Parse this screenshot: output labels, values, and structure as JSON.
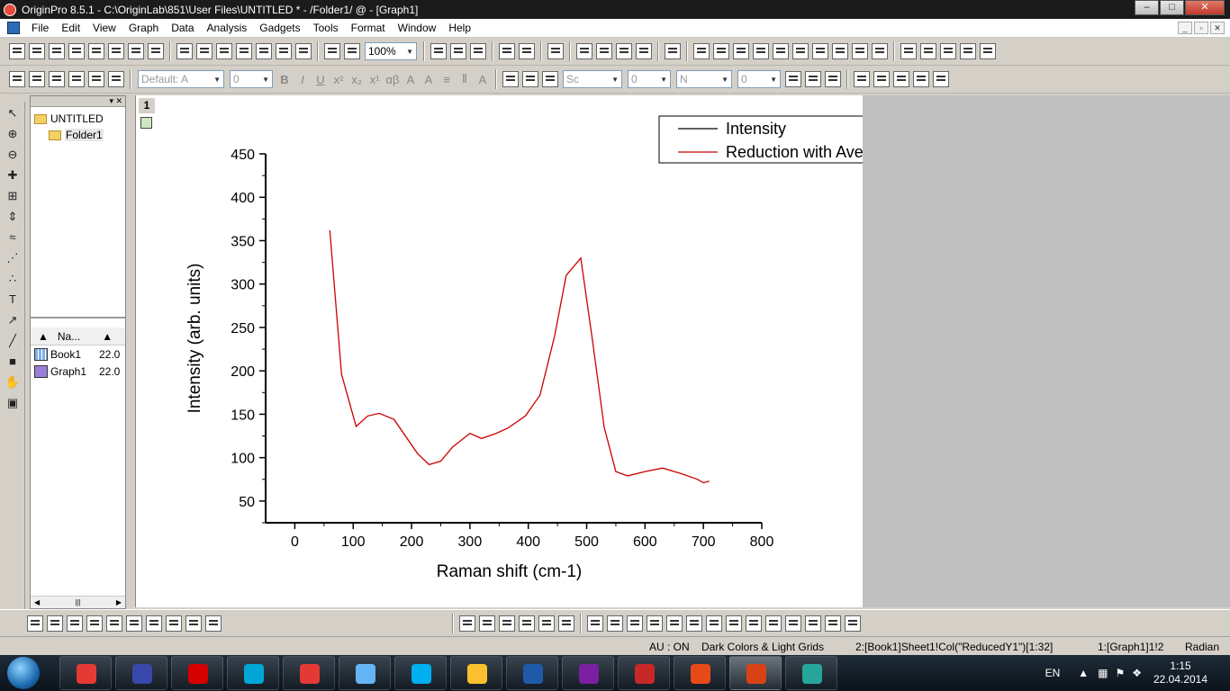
{
  "window": {
    "title": "OriginPro 8.5.1 - C:\\OriginLab\\851\\User Files\\UNTITLED * - /Folder1/ @ - [Graph1]"
  },
  "menu": [
    "File",
    "Edit",
    "View",
    "Graph",
    "Data",
    "Analysis",
    "Gadgets",
    "Tools",
    "Format",
    "Window",
    "Help"
  ],
  "toolbar": {
    "zoom": "100%",
    "font_name": "Default: A",
    "font_size": "0",
    "line_style": "Sc",
    "line_width": "0",
    "border_color": "N",
    "pattern_width": "0"
  },
  "explorer": {
    "root": "UNTITLED",
    "folder": "Folder1",
    "list_header": "Na...",
    "items": [
      {
        "name": "Book1",
        "date": "22.0"
      },
      {
        "name": "Graph1",
        "date": "22.0"
      }
    ]
  },
  "graph": {
    "page_number": "1"
  },
  "chart_data": {
    "type": "line",
    "xlabel": "Raman shift (cm-1)",
    "ylabel": "Intensity (arb. units)",
    "xlim": [
      -50,
      800
    ],
    "ylim": [
      25,
      450
    ],
    "xticks": [
      0,
      100,
      200,
      300,
      400,
      500,
      600,
      700,
      800
    ],
    "yticks": [
      50,
      100,
      150,
      200,
      250,
      300,
      350,
      400,
      450
    ],
    "legend": {
      "placement": "top-right",
      "entries": [
        "Intensity",
        "Reduction with Average of \"Intensity\""
      ]
    },
    "series": [
      {
        "name": "Intensity",
        "color": "#000000",
        "x": [],
        "y": []
      },
      {
        "name": "Reduction with Average of \"Intensity\"",
        "color": "#cc0000",
        "x": [
          60,
          80,
          105,
          125,
          145,
          170,
          210,
          230,
          250,
          270,
          300,
          320,
          345,
          365,
          395,
          420,
          445,
          465,
          490,
          510,
          530,
          550,
          570,
          600,
          630,
          660,
          690,
          700,
          710
        ],
        "y": [
          362,
          196,
          136,
          148,
          151,
          144,
          105,
          92,
          96,
          112,
          128,
          122,
          128,
          134,
          148,
          172,
          240,
          310,
          330,
          235,
          135,
          84,
          79,
          84,
          88,
          82,
          75,
          71,
          73
        ]
      }
    ]
  },
  "status": {
    "au": "AU : ON",
    "theme": "Dark Colors & Light Grids",
    "column": "2:[Book1]Sheet1!Col(\"ReducedY1\")[1:32]",
    "layer": "1:[Graph1]1!2",
    "angle": "Radian"
  },
  "taskbar": {
    "lang": "EN",
    "time": "1:15",
    "date": "22.04.2014"
  }
}
